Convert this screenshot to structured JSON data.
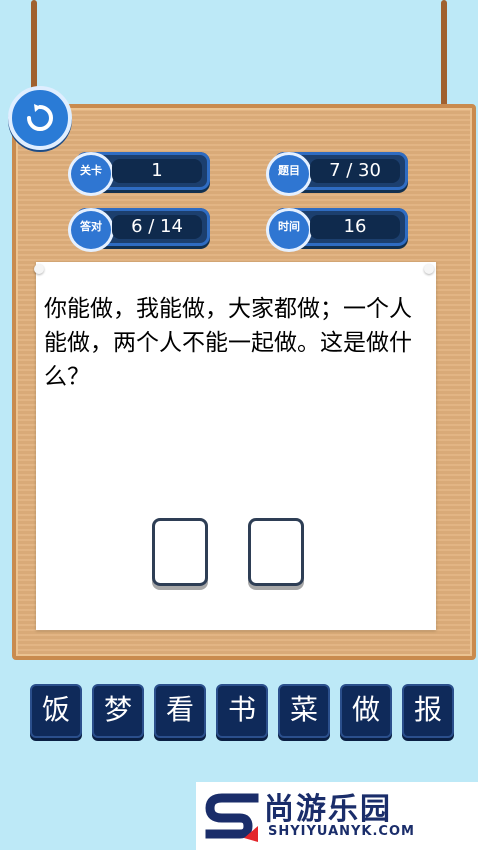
{
  "stats": {
    "level": {
      "label": "关卡",
      "value": "1"
    },
    "question": {
      "label": "题目",
      "value": "7 / 30"
    },
    "correct": {
      "label": "答对",
      "value": "6 / 14"
    },
    "time": {
      "label": "时间",
      "value": "16"
    }
  },
  "question_text": "你能做，我能做，大家都做；一个人能做，两个人不能一起做。这是做什么？",
  "answer_slots": [
    "",
    ""
  ],
  "choices": [
    "饭",
    "梦",
    "看",
    "书",
    "菜",
    "做",
    "报"
  ],
  "watermark": {
    "cn": "尚游乐园",
    "en": "SHYIYUANYK.COM"
  },
  "colors": {
    "accent": "#2f76d2",
    "board": "#e0b07c",
    "key": "#0f2a5a",
    "background": "#bde9f7"
  }
}
